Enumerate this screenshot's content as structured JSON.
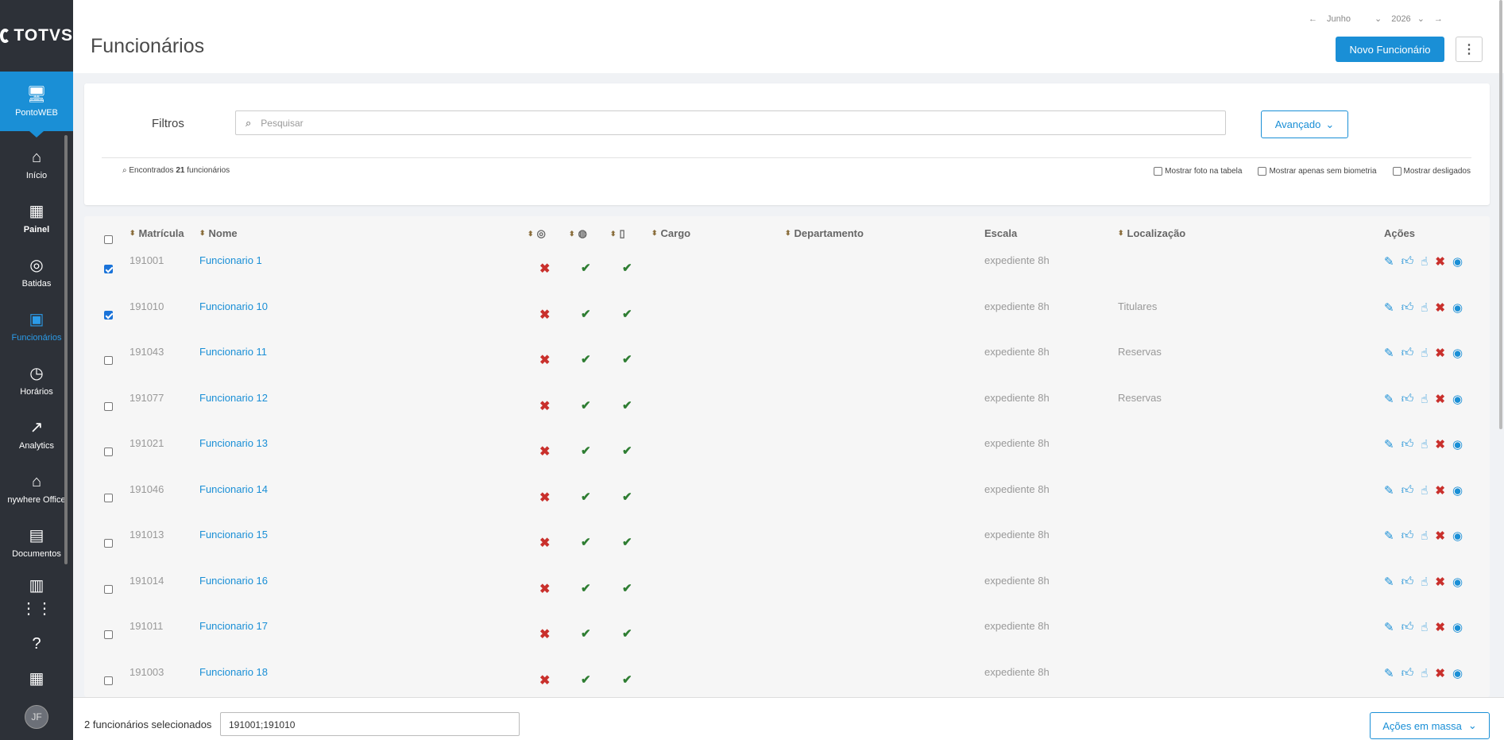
{
  "brand": {
    "logo_text": "TOTVS"
  },
  "sidebar": {
    "items": [
      {
        "label": "PontoWEB",
        "icon": "monitor-icon"
      },
      {
        "label": "Início",
        "icon": "home-icon"
      },
      {
        "label": "Painel",
        "icon": "dashboard-icon"
      },
      {
        "label": "Batidas",
        "icon": "fingerprint-icon"
      },
      {
        "label": "Funcionários",
        "icon": "badge-icon"
      },
      {
        "label": "Horários",
        "icon": "clock-icon"
      },
      {
        "label": "Analytics",
        "icon": "trend-icon"
      },
      {
        "label": "nywhere Office",
        "icon": "building-icon"
      },
      {
        "label": "Documentos",
        "icon": "document-icon"
      }
    ],
    "avatar_initials": "JF"
  },
  "header": {
    "title": "Funcionários",
    "month": "Junho",
    "year": "2026",
    "new_button": "Novo Funcionário"
  },
  "filters": {
    "label": "Filtros",
    "search_placeholder": "Pesquisar",
    "advanced_button": "Avançado",
    "found_prefix": "Encontrados",
    "found_count": "21",
    "found_suffix": "funcionários",
    "options": [
      "Mostrar foto na tabela",
      "Mostrar apenas sem biometria",
      "Mostrar desligados"
    ]
  },
  "table": {
    "headers": {
      "matricula": "Matrícula",
      "nome": "Nome",
      "cargo": "Cargo",
      "departamento": "Departamento",
      "escala": "Escala",
      "localizacao": "Localização",
      "acoes": "Ações"
    },
    "rows": [
      {
        "matricula": "191001",
        "nome": "Funcionario 1",
        "escala": "expediente 8h",
        "localizacao": "",
        "checked": true
      },
      {
        "matricula": "191010",
        "nome": "Funcionario 10",
        "escala": "expediente 8h",
        "localizacao": "Titulares",
        "checked": true
      },
      {
        "matricula": "191043",
        "nome": "Funcionario 11",
        "escala": "expediente 8h",
        "localizacao": "Reservas",
        "checked": false
      },
      {
        "matricula": "191077",
        "nome": "Funcionario 12",
        "escala": "expediente 8h",
        "localizacao": "Reservas",
        "checked": false
      },
      {
        "matricula": "191021",
        "nome": "Funcionario 13",
        "escala": "expediente 8h",
        "localizacao": "",
        "checked": false
      },
      {
        "matricula": "191046",
        "nome": "Funcionario 14",
        "escala": "expediente 8h",
        "localizacao": "",
        "checked": false
      },
      {
        "matricula": "191013",
        "nome": "Funcionario 15",
        "escala": "expediente 8h",
        "localizacao": "",
        "checked": false
      },
      {
        "matricula": "191014",
        "nome": "Funcionario 16",
        "escala": "expediente 8h",
        "localizacao": "",
        "checked": false
      },
      {
        "matricula": "191011",
        "nome": "Funcionario 17",
        "escala": "expediente 8h",
        "localizacao": "",
        "checked": false
      },
      {
        "matricula": "191003",
        "nome": "Funcionario 18",
        "escala": "expediente 8h",
        "localizacao": "",
        "checked": false
      }
    ]
  },
  "footer": {
    "selected_text": "2 funcionários selecionados",
    "selected_ids": "191001;191010",
    "mass_actions": "Ações em massa"
  },
  "colors": {
    "accent": "#1a8fd6",
    "sidebar": "#2d3138",
    "ok": "#2e7d32",
    "error": "#c9302c"
  }
}
